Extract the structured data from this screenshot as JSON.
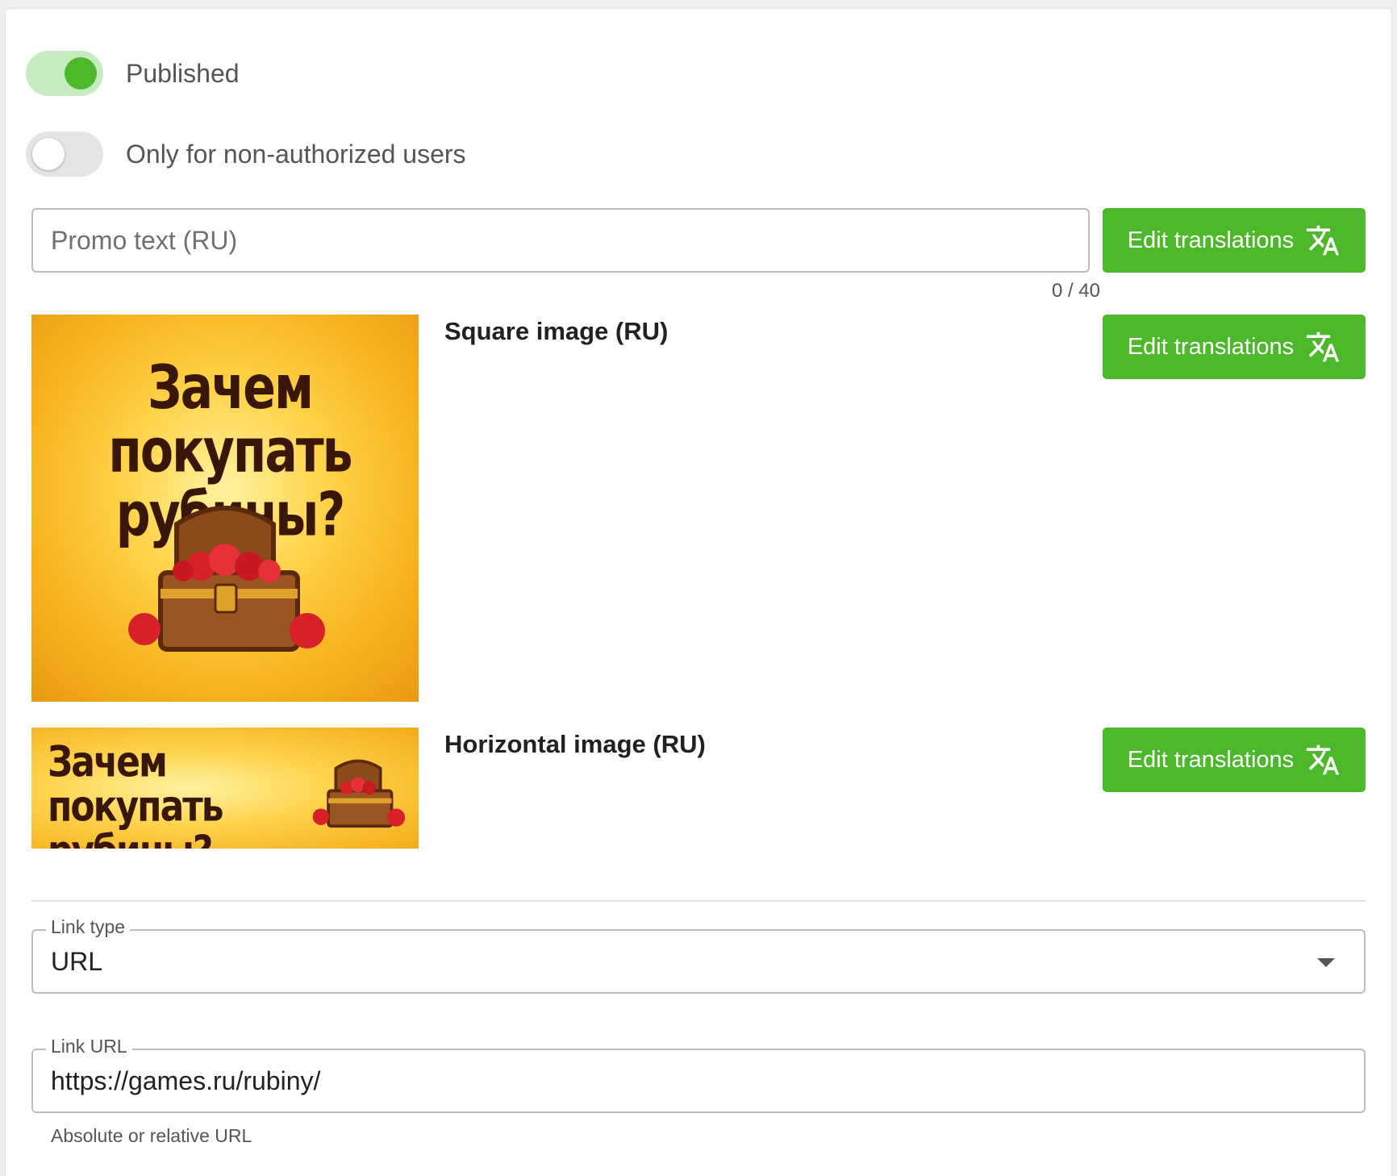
{
  "toggles": {
    "published": {
      "label": "Published",
      "on": true
    },
    "non_authorized": {
      "label": "Only for non-authorized users",
      "on": false
    }
  },
  "promo": {
    "placeholder": "Promo text (RU)",
    "counter": "0 / 40"
  },
  "buttons": {
    "edit_translations": "Edit translations"
  },
  "square_image": {
    "title": "Square image (RU)",
    "line1": "Зачем покупать",
    "line2": "рубины?"
  },
  "horizontal_image": {
    "title": "Horizontal image (RU)",
    "line1": "Зачем покупать",
    "line2": "рубины?"
  },
  "link_type": {
    "label": "Link type",
    "value": "URL"
  },
  "link_url": {
    "label": "Link URL",
    "value": "https://games.ru/rubiny/",
    "helper": "Absolute or relative URL"
  },
  "colors": {
    "accent": "#4cb82a",
    "toggle_track_on": "#c6ebc0",
    "border": "#bdbdbd"
  },
  "icons": {
    "translate": "translate-icon",
    "dropdown": "chevron-down-icon"
  }
}
